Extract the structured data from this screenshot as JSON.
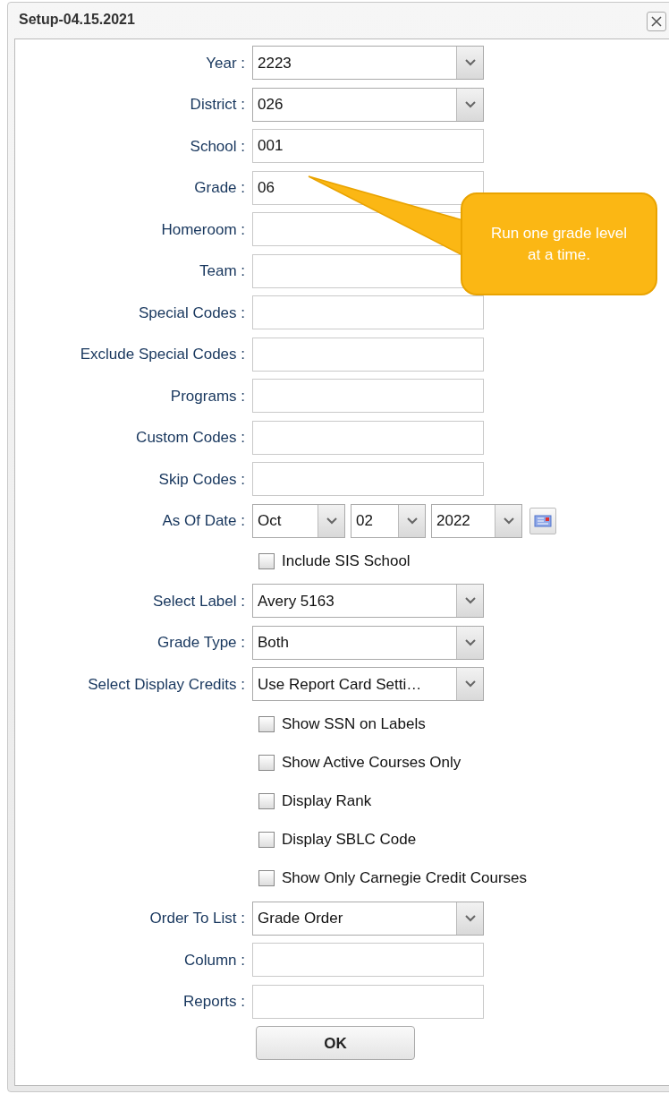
{
  "window": {
    "title": "Setup-04.15.2021"
  },
  "fields": [
    {
      "kind": "select",
      "label": "Year :",
      "value": "2223"
    },
    {
      "kind": "select",
      "label": "District :",
      "value": "026"
    },
    {
      "kind": "text",
      "label": "School :",
      "value": "001"
    },
    {
      "kind": "text",
      "label": "Grade :",
      "value": "06"
    },
    {
      "kind": "text",
      "label": "Homeroom :"
    },
    {
      "kind": "text",
      "label": "Team :"
    },
    {
      "kind": "text",
      "label": "Special Codes :"
    },
    {
      "kind": "text",
      "label": "Exclude Special Codes :"
    },
    {
      "kind": "text",
      "label": "Programs :"
    },
    {
      "kind": "text",
      "label": "Custom Codes :"
    },
    {
      "kind": "text",
      "label": "Skip Codes :"
    },
    {
      "kind": "date",
      "label": "As Of Date :",
      "month": "Oct",
      "day": "02",
      "year": "2022"
    },
    {
      "kind": "checkbox",
      "label": "Include SIS School",
      "checked": false
    },
    {
      "kind": "select",
      "label": "Select Label :",
      "value": "Avery 5163"
    },
    {
      "kind": "select",
      "label": "Grade Type :",
      "value": "Both"
    },
    {
      "kind": "select",
      "label": "Select Display Credits :",
      "value": "Use Report Card Setti…"
    },
    {
      "kind": "checkbox",
      "label": "Show SSN on Labels",
      "checked": false
    },
    {
      "kind": "checkbox",
      "label": "Show Active Courses Only",
      "checked": false
    },
    {
      "kind": "checkbox",
      "label": "Display Rank",
      "checked": false
    },
    {
      "kind": "checkbox",
      "label": "Display SBLC Code",
      "checked": false
    },
    {
      "kind": "checkbox",
      "label": "Show Only Carnegie Credit Courses",
      "checked": false
    },
    {
      "kind": "select",
      "label": "Order To List :",
      "value": "Grade Order"
    },
    {
      "kind": "text",
      "label": "Column :"
    },
    {
      "kind": "text",
      "label": "Reports :"
    }
  ],
  "ok_button": "OK",
  "callout": "Run one grade level at a time."
}
